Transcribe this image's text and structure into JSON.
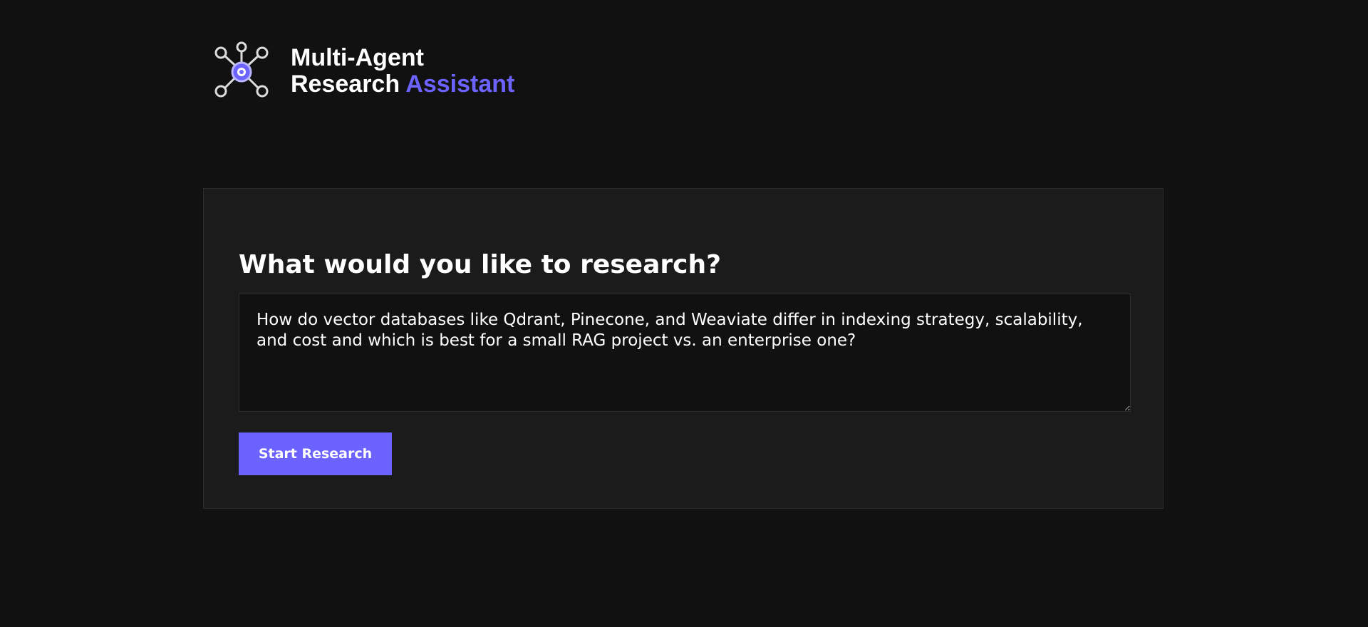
{
  "header": {
    "title_line1": "Multi-Agent",
    "title_line2_main": "Research",
    "title_line2_accent": "Assistant",
    "logo_icon": "network-nodes-icon"
  },
  "main": {
    "heading": "What would you like to research?",
    "query_value": "How do vector databases like Qdrant, Pinecone, and Weaviate differ in indexing strategy, scalability, and cost and which is best for a small RAG project vs. an enterprise one?",
    "start_button_label": "Start Research"
  },
  "colors": {
    "background": "#111111",
    "card": "#1b1b1b",
    "accent": "#6c63ff",
    "text": "#ffffff"
  }
}
